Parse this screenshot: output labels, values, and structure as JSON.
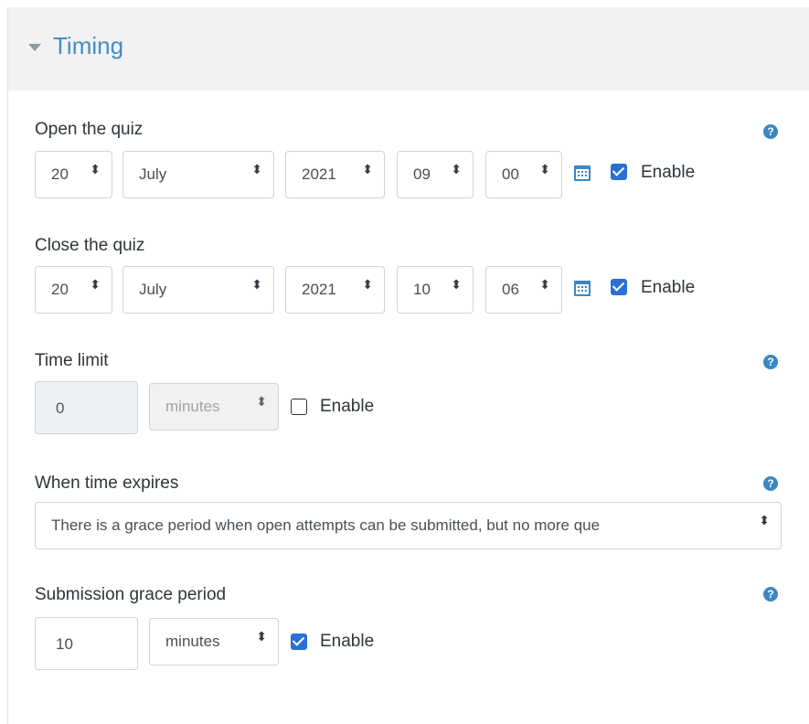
{
  "section": {
    "title": "Timing",
    "caret_icon": "caret-down-icon"
  },
  "open_quiz": {
    "label": "Open the quiz",
    "day": "20",
    "month": "July",
    "year": "2021",
    "hour": "09",
    "minute": "00",
    "enable_label": "Enable",
    "enabled": true
  },
  "close_quiz": {
    "label": "Close the quiz",
    "day": "20",
    "month": "July",
    "year": "2021",
    "hour": "10",
    "minute": "06",
    "enable_label": "Enable",
    "enabled": true
  },
  "time_limit": {
    "label": "Time limit",
    "value": "0",
    "unit": "minutes",
    "enable_label": "Enable",
    "enabled": false
  },
  "when_expires": {
    "label": "When time expires",
    "value": "There is a grace period when open attempts can be submitted, but no more que"
  },
  "grace_period": {
    "label": "Submission grace period",
    "value": "10",
    "unit": "minutes",
    "enable_label": "Enable",
    "enabled": true
  },
  "help_icon": "?",
  "select_arrow": "⬍",
  "colors": {
    "accent": "#3f8ec7",
    "checkbox": "#2b6fd6",
    "header_bg": "#f2f2f2"
  }
}
